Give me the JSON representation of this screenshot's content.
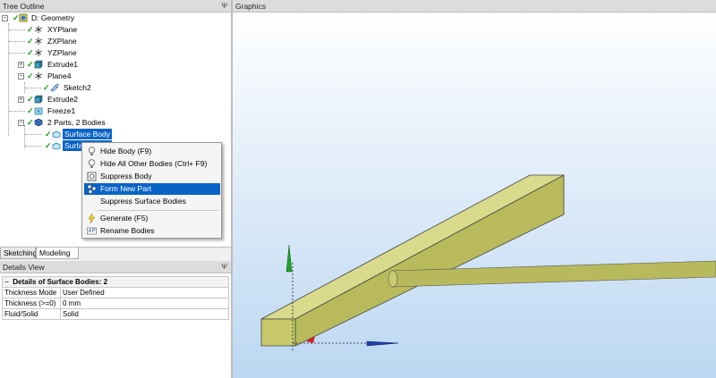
{
  "tree_outline": {
    "title": "Tree Outline",
    "items": [
      {
        "label": "D: Geometry"
      },
      {
        "label": "XYPlane"
      },
      {
        "label": "ZXPlane"
      },
      {
        "label": "YZPlane"
      },
      {
        "label": "Extrude1"
      },
      {
        "label": "Plane4"
      },
      {
        "label": "Sketch2"
      },
      {
        "label": "Extrude2"
      },
      {
        "label": "Freeze1"
      },
      {
        "label": "2 Parts, 2 Bodies"
      },
      {
        "label": "Surface Body"
      },
      {
        "label": "Surface Body"
      }
    ]
  },
  "graphics": {
    "title": "Graphics"
  },
  "context_menu": {
    "items": [
      {
        "label": "Hide Body (F9)"
      },
      {
        "label": "Hide All Other Bodies (Ctrl+ F9)"
      },
      {
        "label": "Suppress Body"
      },
      {
        "label": "Form New Part"
      },
      {
        "label": "Suppress Surface Bodies"
      },
      {
        "label": "Generate (F5)"
      },
      {
        "label": "Rename Bodies"
      }
    ]
  },
  "tabs": [
    {
      "label": "Sketching"
    },
    {
      "label": "Modeling"
    }
  ],
  "details": {
    "title": "Details View",
    "group": "Details of Surface Bodies: 2",
    "rows": [
      {
        "key": "Thickness Mode",
        "value": "User Defined"
      },
      {
        "key": "Thickness (>=0)",
        "value": "0 mm"
      },
      {
        "key": "Fluid/Solid",
        "value": "Solid"
      }
    ]
  },
  "pin_glyph": "Ψ",
  "colors": {
    "selection": "#0a64c8",
    "body_fill": "#c8c96a",
    "axis_x": "#1f3fb0",
    "axis_y": "#1fa02a",
    "axis_z": "#d02020"
  }
}
